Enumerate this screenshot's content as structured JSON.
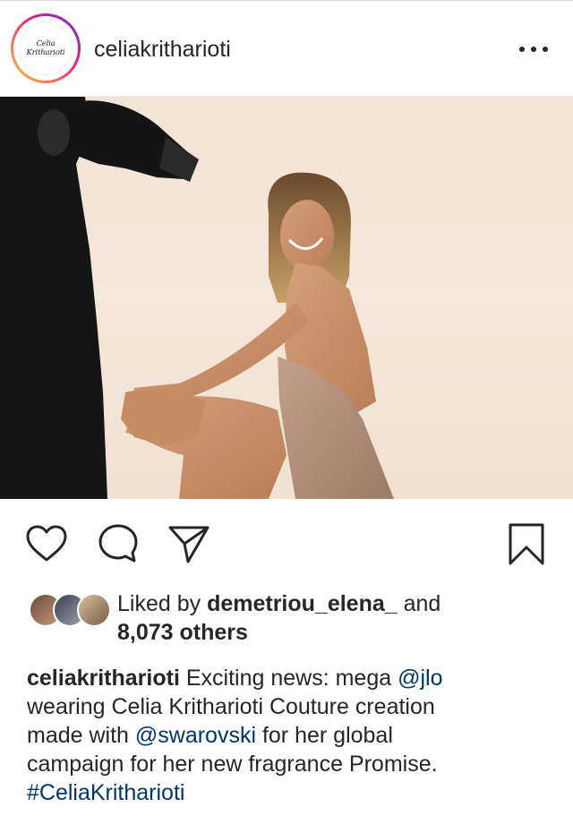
{
  "post": {
    "username": "celiakritharioti",
    "avatar_text": "Celia Kritharioti"
  },
  "likes": {
    "prefix": "Liked by ",
    "user": "demetriou_elena_",
    "and": " and",
    "others": "8,073 others"
  },
  "caption": {
    "username": "celiakritharioti",
    "line1_text": " Exciting news: mega ",
    "mention1": "@jlo",
    "line2": "wearing Celia Kritharioti Couture creation",
    "line3_pre": "made with ",
    "mention2": "@swarovski",
    "line3_post": " for her global",
    "line4": "campaign for her new fragrance Promise.",
    "hashtag": "#CeliaKritharioti"
  },
  "icons": {
    "like": "heart-icon",
    "comment": "comment-icon",
    "share": "paper-plane-icon",
    "save": "bookmark-icon",
    "more": "more-options-icon"
  }
}
